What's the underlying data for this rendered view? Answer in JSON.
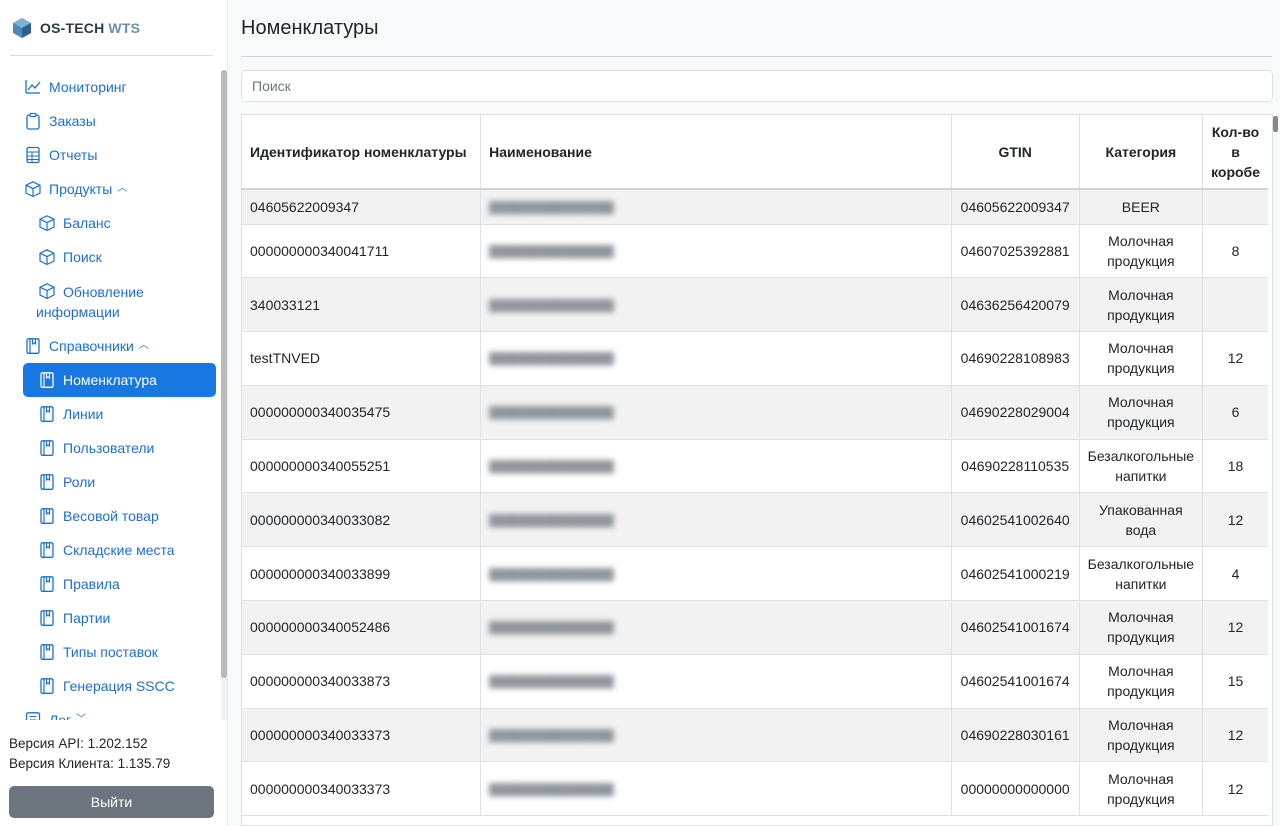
{
  "app": {
    "logo_main": "OS-TECH",
    "logo_accent": "WTS"
  },
  "sidebar": {
    "items": [
      {
        "label": "Мониторинг",
        "icon": "chart-line-icon"
      },
      {
        "label": "Заказы",
        "icon": "clipboard-icon"
      },
      {
        "label": "Отчеты",
        "icon": "spreadsheet-icon"
      },
      {
        "label": "Продукты",
        "icon": "box-icon",
        "expanded": true
      },
      {
        "label": "Баланс",
        "icon": "box-icon"
      },
      {
        "label": "Поиск",
        "icon": "box-icon"
      },
      {
        "label": "Обновление информации",
        "icon": "box-icon"
      },
      {
        "label": "Справочники",
        "icon": "book-icon",
        "expanded": true
      },
      {
        "label": "Номенклатура",
        "icon": "book-icon",
        "active": true
      },
      {
        "label": "Линии",
        "icon": "book-icon"
      },
      {
        "label": "Пользователи",
        "icon": "book-icon"
      },
      {
        "label": "Роли",
        "icon": "book-icon"
      },
      {
        "label": "Весовой товар",
        "icon": "book-icon"
      },
      {
        "label": "Складские места",
        "icon": "book-icon"
      },
      {
        "label": "Правила",
        "icon": "book-icon"
      },
      {
        "label": "Партии",
        "icon": "book-icon"
      },
      {
        "label": "Типы поставок",
        "icon": "book-icon"
      },
      {
        "label": "Генерация SSCC",
        "icon": "book-icon"
      },
      {
        "label": "Лог",
        "icon": "list-icon",
        "expanded": false
      }
    ],
    "api_version": "Версия API: 1.202.152",
    "client_version": "Версия Клиента: 1.135.79",
    "logout_label": "Выйти"
  },
  "main": {
    "title": "Номенклатуры",
    "search_placeholder": "Поиск",
    "table": {
      "headers": [
        "Идентификатор номенклатуры",
        "Наименование",
        "GTIN",
        "Категория",
        "Кол-во в коробе"
      ],
      "rows": [
        [
          "04605622009347",
          "",
          "04605622009347",
          "BEER",
          ""
        ],
        [
          "000000000340041711",
          "",
          "04607025392881",
          "Молочная продукция",
          "8"
        ],
        [
          "340033121",
          "",
          "04636256420079",
          "Молочная продукция",
          ""
        ],
        [
          "testTNVED",
          "",
          "04690228108983",
          "Молочная продукция",
          "12"
        ],
        [
          "000000000340035475",
          "",
          "04690228029004",
          "Молочная продукция",
          "6"
        ],
        [
          "000000000340055251",
          "",
          "04690228110535",
          "Безалкогольные напитки",
          "18"
        ],
        [
          "000000000340033082",
          "",
          "04602541002640",
          "Упакованная вода",
          "12"
        ],
        [
          "000000000340033899",
          "",
          "04602541000219",
          "Безалкогольные напитки",
          "4"
        ],
        [
          "000000000340052486",
          "",
          "04602541001674",
          "Молочная продукция",
          "12"
        ],
        [
          "000000000340033873",
          "",
          "04602541001674",
          "Молочная продукция",
          "15"
        ],
        [
          "000000000340033373",
          "",
          "04690228030161",
          "Молочная продукция",
          "12"
        ],
        [
          "000000000340033373",
          "",
          "00000000000000",
          "Молочная продукция",
          "12"
        ]
      ]
    }
  }
}
